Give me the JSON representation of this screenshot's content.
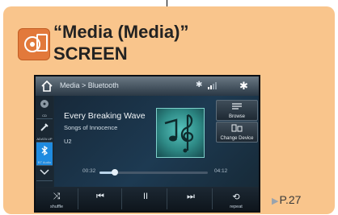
{
  "header": {
    "title_line1": "“Media (Media)”",
    "title_line2": "SCREEN"
  },
  "screen": {
    "breadcrumb": "Media > Bluetooth",
    "left_buttons": [
      {
        "label": "CD"
      },
      {
        "label": "ADATA UP"
      },
      {
        "label": "BT Audio"
      }
    ],
    "track": {
      "title": "Every Breaking Wave",
      "album": "Songs of Innocence",
      "artist": "U2"
    },
    "time_elapsed": "00:32",
    "time_total": "04:12",
    "progress": 0.14,
    "right_buttons": {
      "browse": "Browse",
      "change_device": "Change Device"
    },
    "controls": {
      "shuffle": "shuffle",
      "prev_icon": "⏮",
      "pause_icon": "II",
      "next_icon": "⏭",
      "repeat": "repeat"
    },
    "colors": {
      "active_source": "#1f8be0"
    }
  },
  "page_ref": "P.27"
}
